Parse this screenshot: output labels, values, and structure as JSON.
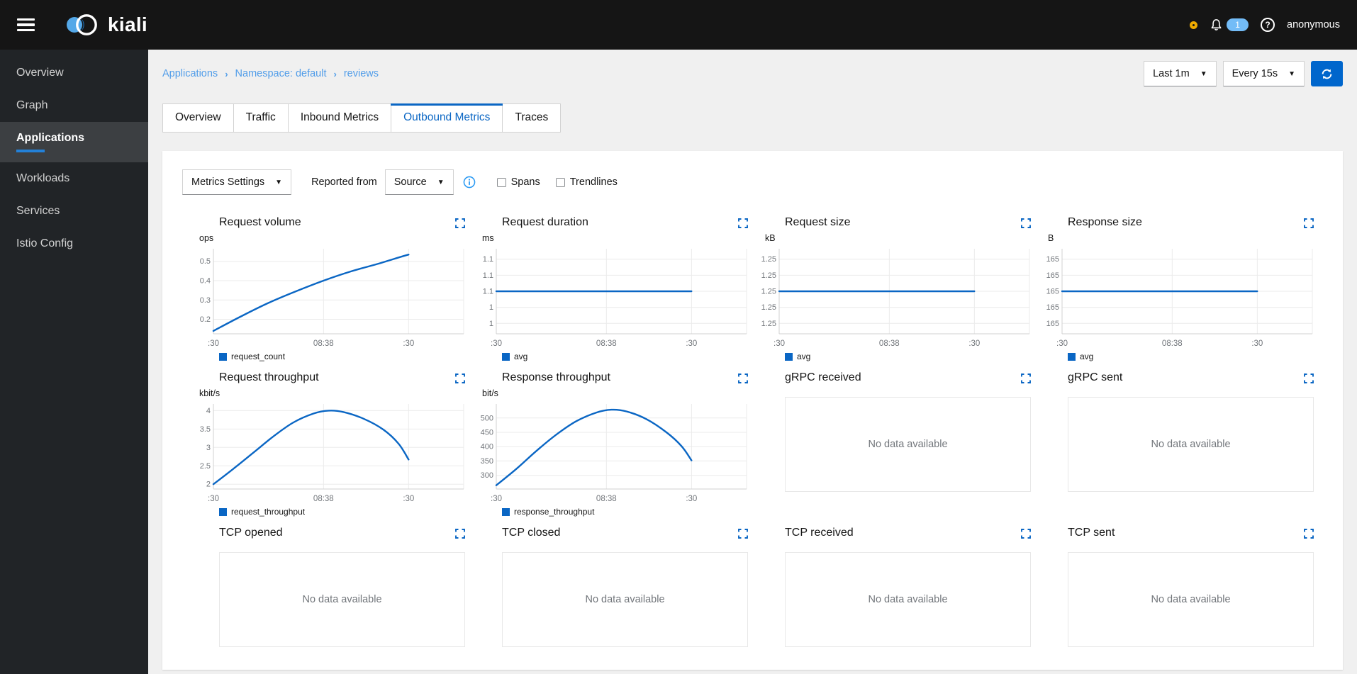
{
  "masthead": {
    "brand": "kiali",
    "notification_count": "1",
    "user": "anonymous"
  },
  "sidebar": {
    "items": [
      {
        "label": "Overview",
        "active": false
      },
      {
        "label": "Graph",
        "active": false
      },
      {
        "label": "Applications",
        "active": true
      },
      {
        "label": "Workloads",
        "active": false
      },
      {
        "label": "Services",
        "active": false
      },
      {
        "label": "Istio Config",
        "active": false
      }
    ]
  },
  "breadcrumb": {
    "items": [
      "Applications",
      "Namespace: default",
      "reviews"
    ]
  },
  "time_toolbar": {
    "duration": "Last 1m",
    "refresh_interval": "Every 15s"
  },
  "tabs": [
    {
      "label": "Overview",
      "active": false
    },
    {
      "label": "Traffic",
      "active": false
    },
    {
      "label": "Inbound Metrics",
      "active": false
    },
    {
      "label": "Outbound Metrics",
      "active": true
    },
    {
      "label": "Traces",
      "active": false
    }
  ],
  "metrics_toolbar": {
    "settings": "Metrics Settings",
    "reported_from": "Reported from",
    "source": "Source",
    "spans": "Spans",
    "trendlines": "Trendlines",
    "spans_checked": false,
    "trendlines_checked": false
  },
  "chart_defaults": {
    "x_labels": [
      ":30",
      "08:38",
      ":30"
    ],
    "x_fracs": [
      0,
      0.44,
      0.78
    ],
    "empty_text": "No data available"
  },
  "chart_data": [
    {
      "title": "Request volume",
      "type": "line",
      "unit": "ops",
      "y_tick_labels": [
        "0.5",
        "0.4",
        "0.3",
        "0.2"
      ],
      "y_tick_values": [
        0.5,
        0.4,
        0.3,
        0.2
      ],
      "ylim": [
        0.125,
        0.565
      ],
      "series": [
        {
          "name": "request_count",
          "points": [
            [
              0,
              0.14
            ],
            [
              0.11,
              0.215
            ],
            [
              0.22,
              0.285
            ],
            [
              0.33,
              0.345
            ],
            [
              0.44,
              0.4
            ],
            [
              0.55,
              0.448
            ],
            [
              0.66,
              0.488
            ],
            [
              0.72,
              0.512
            ],
            [
              0.78,
              0.535
            ]
          ]
        }
      ]
    },
    {
      "title": "Request duration",
      "type": "line",
      "unit": "ms",
      "y_tick_labels": [
        "1.1",
        "1.1",
        "1.1",
        "1",
        "1"
      ],
      "y_tick_values": [
        5,
        4,
        3,
        2,
        1
      ],
      "ylim": [
        0.35,
        5.65
      ],
      "series": [
        {
          "name": "avg",
          "points": [
            [
              0,
              3
            ],
            [
              0.78,
              3
            ]
          ]
        }
      ]
    },
    {
      "title": "Request size",
      "type": "line",
      "unit": "kB",
      "y_tick_labels": [
        "1.25",
        "1.25",
        "1.25",
        "1.25",
        "1.25"
      ],
      "y_tick_values": [
        5,
        4,
        3,
        2,
        1
      ],
      "ylim": [
        0.35,
        5.65
      ],
      "series": [
        {
          "name": "avg",
          "points": [
            [
              0,
              3
            ],
            [
              0.78,
              3
            ]
          ]
        }
      ]
    },
    {
      "title": "Response size",
      "type": "line",
      "unit": "B",
      "y_tick_labels": [
        "165",
        "165",
        "165",
        "165",
        "165"
      ],
      "y_tick_values": [
        5,
        4,
        3,
        2,
        1
      ],
      "ylim": [
        0.35,
        5.65
      ],
      "series": [
        {
          "name": "avg",
          "points": [
            [
              0,
              3
            ],
            [
              0.78,
              3
            ]
          ]
        }
      ]
    },
    {
      "title": "Request throughput",
      "type": "line",
      "unit": "kbit/s",
      "y_tick_labels": [
        "4",
        "3.5",
        "3",
        "2.5",
        "2"
      ],
      "y_tick_values": [
        4,
        3.5,
        3,
        2.5,
        2
      ],
      "ylim": [
        1.87,
        4.18
      ],
      "series": [
        {
          "name": "request_throughput",
          "points": [
            [
              0,
              2.0
            ],
            [
              0.08,
              2.42
            ],
            [
              0.16,
              2.86
            ],
            [
              0.24,
              3.3
            ],
            [
              0.32,
              3.68
            ],
            [
              0.4,
              3.92
            ],
            [
              0.46,
              4.0
            ],
            [
              0.52,
              3.96
            ],
            [
              0.6,
              3.78
            ],
            [
              0.68,
              3.48
            ],
            [
              0.74,
              3.1
            ],
            [
              0.78,
              2.67
            ]
          ]
        }
      ]
    },
    {
      "title": "Response throughput",
      "type": "line",
      "unit": "bit/s",
      "y_tick_labels": [
        "500",
        "450",
        "400",
        "350",
        "300"
      ],
      "y_tick_values": [
        500,
        450,
        400,
        350,
        300
      ],
      "ylim": [
        252,
        549
      ],
      "series": [
        {
          "name": "response_throughput",
          "points": [
            [
              0,
              265
            ],
            [
              0.08,
              322
            ],
            [
              0.16,
              385
            ],
            [
              0.24,
              442
            ],
            [
              0.32,
              489
            ],
            [
              0.4,
              519
            ],
            [
              0.46,
              529
            ],
            [
              0.52,
              523
            ],
            [
              0.6,
              496
            ],
            [
              0.68,
              450
            ],
            [
              0.74,
              402
            ],
            [
              0.78,
              352
            ]
          ]
        }
      ]
    },
    {
      "title": "gRPC received",
      "type": "empty"
    },
    {
      "title": "gRPC sent",
      "type": "empty"
    },
    {
      "title": "TCP opened",
      "type": "empty"
    },
    {
      "title": "TCP closed",
      "type": "empty"
    },
    {
      "title": "TCP received",
      "type": "empty"
    },
    {
      "title": "TCP sent",
      "type": "empty"
    }
  ],
  "colors": {
    "masthead_bg": "#151515",
    "sidebar_bg": "#212427",
    "page_bg": "#f0f0f0",
    "primary_blue": "#0066cc",
    "chart_line": "#0a66c4",
    "link_blue": "#519de9",
    "tab_active_blue": "#0a66c4",
    "warning_orange": "#f0ab00",
    "badge_blue": "#73bcf7",
    "grid_line": "#ebebeb",
    "axis_line": "#d2d2d2",
    "tick_text": "#72767b"
  }
}
